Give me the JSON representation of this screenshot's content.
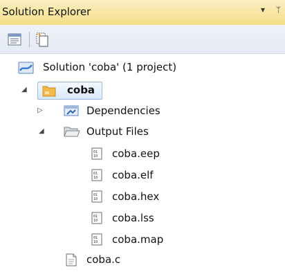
{
  "window": {
    "title": "Solution Explorer",
    "dropdown_glyph": "▾",
    "pin_glyph": "ᛘ"
  },
  "toolbar": {
    "buttons": [
      {
        "icon": "properties-icon"
      },
      {
        "icon": "show-all-files-icon"
      }
    ]
  },
  "tree": {
    "solution": {
      "label": "Solution 'coba' (1 project)",
      "icon": "solution-icon"
    },
    "project": {
      "label": "coba",
      "icon": "project-folder-icon",
      "expanded": true,
      "selected": true
    },
    "dependencies": {
      "label": "Dependencies",
      "icon": "dependencies-icon",
      "expanded": false
    },
    "output_files": {
      "label": "Output Files",
      "icon": "folder-open-icon",
      "expanded": true,
      "files": [
        {
          "label": "coba.eep",
          "icon": "binary-file-icon"
        },
        {
          "label": "coba.elf",
          "icon": "binary-file-icon"
        },
        {
          "label": "coba.hex",
          "icon": "binary-file-icon"
        },
        {
          "label": "coba.lss",
          "icon": "binary-file-icon"
        },
        {
          "label": "coba.map",
          "icon": "binary-file-icon"
        }
      ]
    },
    "source": {
      "label": "coba.c",
      "icon": "source-file-icon"
    }
  },
  "colors": {
    "title_bg": "#f4dd85",
    "selection_border": "#9cb7e0"
  }
}
